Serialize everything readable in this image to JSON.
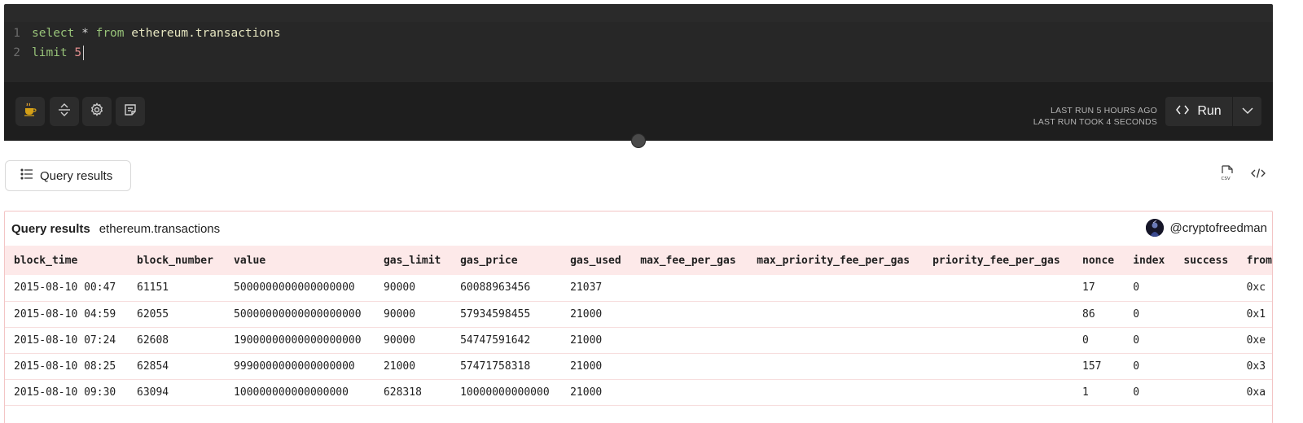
{
  "editor": {
    "lines": [
      {
        "num": "1",
        "tokens": {
          "kw1": "select",
          "op": "*",
          "kw2": "from",
          "table": "ethereum.transactions"
        }
      },
      {
        "num": "2",
        "tokens": {
          "kw": "limit",
          "num": "5"
        }
      }
    ]
  },
  "toolbar": {
    "buttons": [
      "coffee-icon",
      "expand-collapse-icon",
      "gear-icon",
      "notes-icon"
    ],
    "last_run": "LAST RUN 5 HOURS AGO",
    "last_duration": "LAST RUN TOOK 4 SECONDS",
    "run_label": "Run"
  },
  "results_tab": {
    "label": "Query results"
  },
  "panel": {
    "title": "Query results",
    "source": "ethereum.transactions",
    "author": "@cryptofreedman"
  },
  "table": {
    "columns": [
      "block_time",
      "block_number",
      "value",
      "gas_limit",
      "gas_price",
      "gas_used",
      "max_fee_per_gas",
      "max_priority_fee_per_gas",
      "priority_fee_per_gas",
      "nonce",
      "index",
      "success",
      "from"
    ],
    "rows": [
      [
        "2015-08-10 00:47",
        "61151",
        "5000000000000000000",
        "90000",
        "60088963456",
        "21037",
        "",
        "",
        "",
        "17",
        "0",
        "",
        "0xc"
      ],
      [
        "2015-08-10 04:59",
        "62055",
        "50000000000000000000",
        "90000",
        "57934598455",
        "21000",
        "",
        "",
        "",
        "86",
        "0",
        "",
        "0x1"
      ],
      [
        "2015-08-10 07:24",
        "62608",
        "19000000000000000000",
        "90000",
        "54747591642",
        "21000",
        "",
        "",
        "",
        "0",
        "0",
        "",
        "0xe"
      ],
      [
        "2015-08-10 08:25",
        "62854",
        "9990000000000000000",
        "21000",
        "57471758318",
        "21000",
        "",
        "",
        "",
        "157",
        "0",
        "",
        "0x3"
      ],
      [
        "2015-08-10 09:30",
        "63094",
        "100000000000000000",
        "628318",
        "10000000000000",
        "21000",
        "",
        "",
        "",
        "1",
        "0",
        "",
        "0xa"
      ]
    ]
  }
}
